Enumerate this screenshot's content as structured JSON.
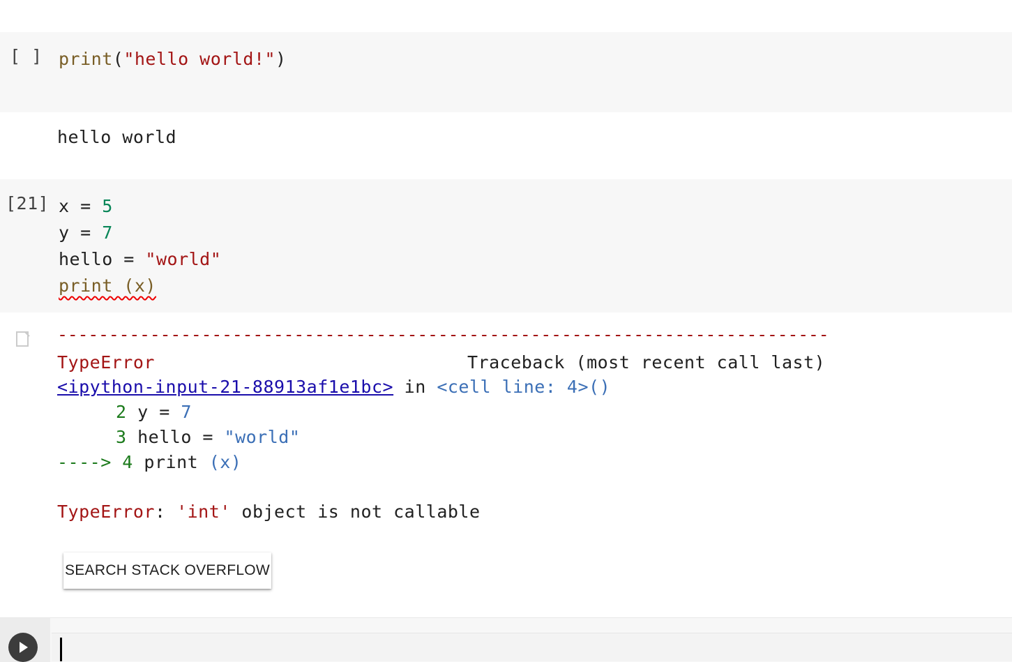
{
  "cell1": {
    "exec_count": "[ ]",
    "code_fn": "print",
    "code_open": "(",
    "code_str": "\"hello world!\"",
    "code_close": ")",
    "output": "hello world"
  },
  "cell2": {
    "exec_count": "[21]",
    "line1_var": "x = ",
    "line1_num": "5",
    "line2_var": "y = ",
    "line2_num": "7",
    "line3_var": "hello = ",
    "line3_str": "\"world\"",
    "line4": "print (x)"
  },
  "error": {
    "dashes": "---------------------------------------------------------------------------",
    "type": "TypeError",
    "traceback_label": "Traceback (most recent call last)",
    "link": "<ipython-input-21-88913af1e1bc>",
    "in_text": " in ",
    "cell_line": "<cell line: 4>()",
    "tb1_num": "2",
    "tb1_code": " y = ",
    "tb1_val": "7",
    "tb2_num": "3",
    "tb2_code": " hello = ",
    "tb2_val": "\"world\"",
    "tb3_arrow": "----> 4",
    "tb3_code": " print ",
    "tb3_val": "(x)",
    "message_type": "TypeError",
    "message_colon": ": ",
    "message_quoted": "'int'",
    "message_rest": " object is not callable"
  },
  "so_button": {
    "label": "SEARCH STACK OVERFLOW"
  },
  "icons": {
    "run": "play-icon",
    "output": "output-icon"
  }
}
